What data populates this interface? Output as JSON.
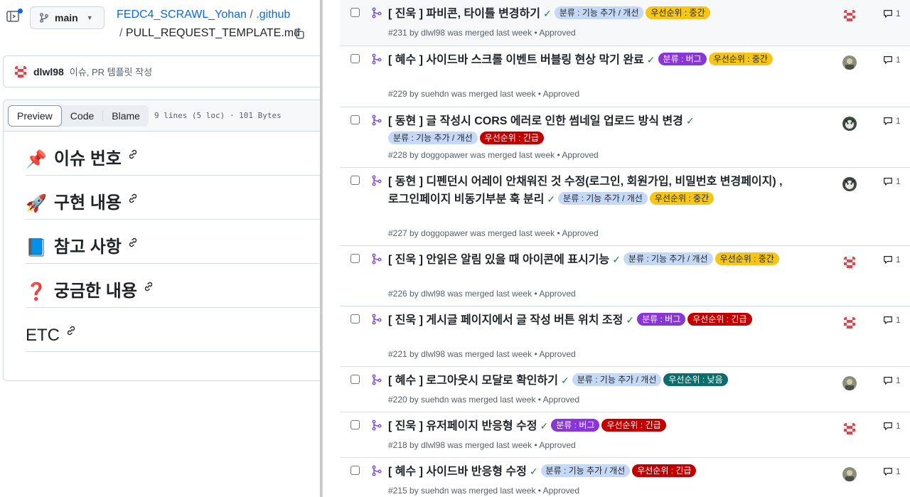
{
  "left": {
    "branch": "main",
    "repo": "FEDC4_SCRAWL_Yohan",
    "path_sep": "/",
    "folder": ".github",
    "file": "PULL_REQUEST_TEMPLATE.md",
    "commit": {
      "user": "dlwl98",
      "message": "이슈, PR 템플릿 작성"
    },
    "tabs": {
      "preview": "Preview",
      "code": "Code",
      "blame": "Blame"
    },
    "file_meta": "9 lines (5 loc) · 101 Bytes",
    "headings": [
      {
        "emoji": "📌",
        "text": "이슈 번호"
      },
      {
        "emoji": "🚀",
        "text": "구현 내용"
      },
      {
        "emoji": "📘",
        "text": "참고 사항"
      },
      {
        "emoji": "❓",
        "text": "궁금한 내용"
      },
      {
        "emoji": "",
        "text": "ETC"
      }
    ]
  },
  "colors": {
    "feature_bg": "#c5d9f6",
    "feature_fg": "#1f2328",
    "bug_bg": "#8a35d6",
    "bug_fg": "#ffffff",
    "mid_bg": "#f5c518",
    "mid_fg": "#1f2328",
    "urgent_bg": "#c00000",
    "urgent_fg": "#ffffff",
    "low_bg": "#0b6e6e",
    "low_fg": "#ffffff",
    "merged_icon": "#8250df"
  },
  "pulls": [
    {
      "title": "[ 진욱 ] 파비콘, 타이틀 변경하기",
      "labels": [
        [
          "분류 : 기능 추가 / 개선",
          "feature"
        ],
        [
          "우선순위 : 중간",
          "mid"
        ]
      ],
      "meta": "#231 by dlwl98 was merged last week • Approved",
      "avatar": "pixel",
      "comments": "1"
    },
    {
      "title": "[ 혜수 ] 사이드바 스크롤 이벤트 버블링 현상 막기 완료",
      "labels": [
        [
          "분류 : 버그",
          "bug"
        ],
        [
          "우선순위 : 중간",
          "mid"
        ]
      ],
      "meta": "#229 by suehdn was merged last week • Approved",
      "avatar": "photo",
      "comments": "1"
    },
    {
      "title": "[ 동현 ] 글 작성시 CORS 에러로 인한 썸네일 업로드 방식 변경",
      "labels": [
        [
          "분류 : 기능 추가 / 개선",
          "feature"
        ],
        [
          "우선순위 : 긴급",
          "urgent"
        ]
      ],
      "meta": "#228 by doggopawer was merged last week • Approved",
      "avatar": "dog",
      "comments": "1"
    },
    {
      "title": "[ 동현 ] 디펜던시 어레이 안채워진 것 수정(로그인, 회원가입, 비밀번호 변경페이지) ,로그인페이지 비동기부분 훅 분리",
      "labels": [
        [
          "분류 : 기능 추가 / 개선",
          "feature"
        ],
        [
          "우선순위 : 중간",
          "mid"
        ]
      ],
      "meta": "#227 by doggopawer was merged last week • Approved",
      "avatar": "dog",
      "comments": "1"
    },
    {
      "title": "[ 진욱 ] 안읽은 알림 있을 때 아이콘에 표시기능",
      "labels": [
        [
          "분류 : 기능 추가 / 개선",
          "feature"
        ],
        [
          "우선순위 : 중간",
          "mid"
        ]
      ],
      "meta": "#226 by dlwl98 was merged last week • Approved",
      "avatar": "pixel",
      "comments": "1"
    },
    {
      "title": "[ 진욱 ] 게시글 페이지에서 글 작성 버튼 위치 조정",
      "labels": [
        [
          "분류 : 버그",
          "bug"
        ],
        [
          "우선순위 : 긴급",
          "urgent"
        ]
      ],
      "meta": "#221 by dlwl98 was merged last week • Approved",
      "avatar": "pixel",
      "comments": "1"
    },
    {
      "title": "[ 혜수 ] 로그아웃시 모달로 확인하기",
      "labels": [
        [
          "분류 : 기능 추가 / 개선",
          "feature"
        ],
        [
          "우선순위 : 낮음",
          "low"
        ]
      ],
      "meta": "#220 by suehdn was merged last week • Approved",
      "avatar": "photo",
      "comments": "1"
    },
    {
      "title": "[ 진욱 ] 유저페이지 반응형 수정",
      "labels": [
        [
          "분류 : 버그",
          "bug"
        ],
        [
          "우선순위 : 긴급",
          "urgent"
        ]
      ],
      "meta": "#218 by dlwl98 was merged last week • Approved",
      "avatar": "pixel",
      "comments": "1"
    },
    {
      "title": "[ 혜수 ] 사이드바 반응형 수정",
      "labels": [
        [
          "분류 : 기능 추가 / 개선",
          "feature"
        ],
        [
          "우선순위 : 긴급",
          "urgent"
        ]
      ],
      "meta": "#215 by suehdn was merged last week • Approved",
      "avatar": "photo",
      "comments": "1"
    }
  ]
}
